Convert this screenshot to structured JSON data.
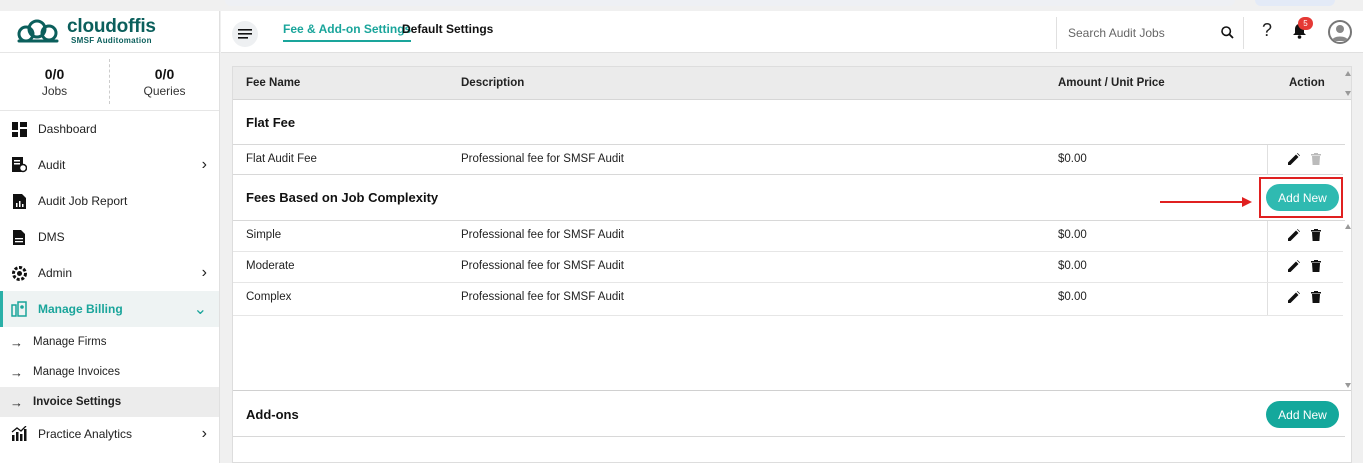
{
  "brand": {
    "name": "cloudoffis",
    "tagline": "SMSF Auditomation",
    "color": "#0b5f5c"
  },
  "stats": [
    {
      "value": "0/0",
      "label": "Jobs"
    },
    {
      "value": "0/0",
      "label": "Queries"
    }
  ],
  "sidebar": {
    "items": [
      {
        "label": "Dashboard",
        "icon": "dashboard-icon"
      },
      {
        "label": "Audit",
        "icon": "audit-icon",
        "expandable": true
      },
      {
        "label": "Audit Job Report",
        "icon": "report-icon"
      },
      {
        "label": "DMS",
        "icon": "document-icon"
      },
      {
        "label": "Admin",
        "icon": "gear-icon",
        "expandable": true
      },
      {
        "label": "Manage Billing",
        "icon": "billing-icon",
        "expanded": true
      }
    ],
    "sub_items": [
      {
        "label": "Manage Firms"
      },
      {
        "label": "Manage Invoices"
      },
      {
        "label": "Invoice Settings",
        "selected": true
      }
    ],
    "after": {
      "label": "Practice Analytics",
      "icon": "analytics-icon"
    }
  },
  "header": {
    "tabs": [
      {
        "label": "Fee & Add-on Settings",
        "active": true
      },
      {
        "label": "Default Settings"
      }
    ],
    "search_placeholder": "Search Audit Jobs",
    "notification_count": "5",
    "help_label": "?"
  },
  "table": {
    "columns": [
      "Fee Name",
      "Description",
      "Amount / Unit Price",
      "Action"
    ],
    "sections": [
      {
        "title": "Flat Fee",
        "rows": [
          {
            "name": "Flat Audit Fee",
            "description": "Professional fee for SMSF Audit",
            "amount": "$0.00"
          }
        ]
      },
      {
        "title": "Fees Based on Job Complexity",
        "button": "Add New",
        "rows": [
          {
            "name": "Simple",
            "description": "Professional fee for SMSF Audit",
            "amount": "$0.00"
          },
          {
            "name": "Moderate",
            "description": "Professional fee for SMSF Audit",
            "amount": "$0.00"
          },
          {
            "name": "Complex",
            "description": "Professional fee for SMSF Audit",
            "amount": "$0.00"
          }
        ]
      },
      {
        "title": "Add-ons",
        "button": "Add New",
        "rows": []
      }
    ]
  },
  "colors": {
    "accent": "#2fbab1",
    "highlight": "#e02020",
    "badge": "#e53935"
  }
}
